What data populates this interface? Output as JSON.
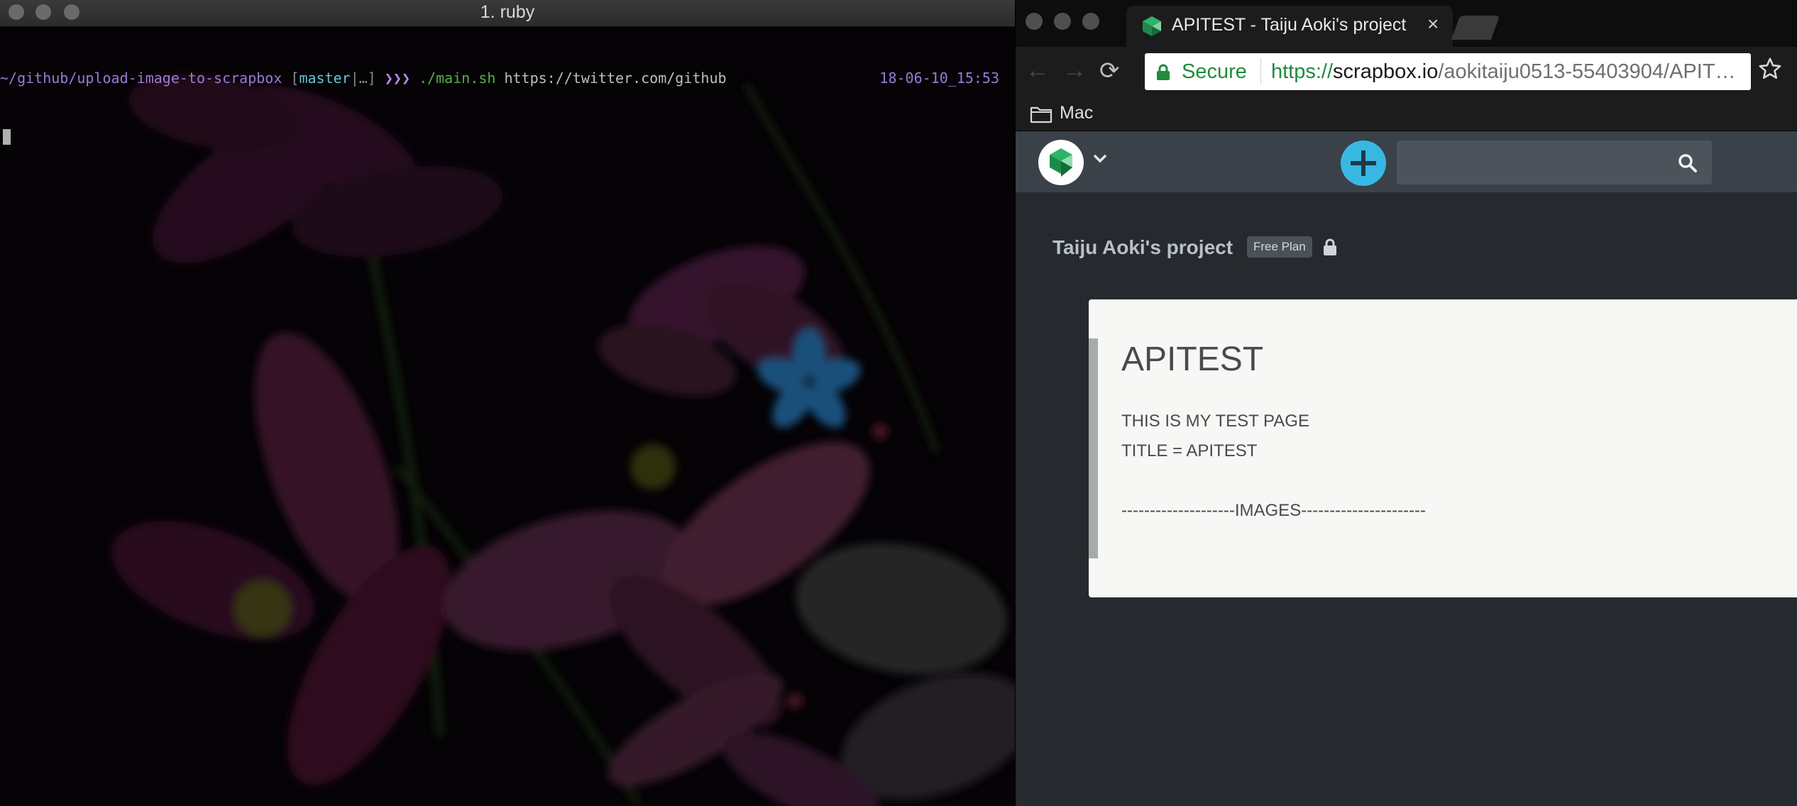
{
  "terminal": {
    "window_title": "1. ruby",
    "prompt_path": "~/github/upload-image-to-scrapbox",
    "branch_open": " [",
    "branch_name": "master",
    "branch_status": "|…",
    "branch_close": "]",
    "prompt_arrows": " ❯❯❯ ",
    "command": "./main.sh",
    "argument": " https://twitter.com/github",
    "timestamp": "18-06-10_15:53"
  },
  "browser": {
    "tab": {
      "title": "APITEST - Taiju Aoki's project",
      "close_glyph": "×",
      "favicon": "scrapbox-logo-icon"
    },
    "nav": {
      "back_glyph": "←",
      "forward_glyph": "→",
      "reload_glyph": "⟳"
    },
    "omnibox": {
      "secure_label": "Secure",
      "url_scheme": "https://",
      "url_host": "scrapbox.io",
      "url_path": "/aokitaiju0513-55403904/APIT…"
    },
    "bookmarks": [
      {
        "label": "Mac",
        "icon": "folder-icon"
      }
    ]
  },
  "scrapbox": {
    "search": {
      "placeholder": ""
    },
    "project": {
      "title": "Taiju Aoki's project",
      "plan_badge": "Free Plan"
    },
    "page": {
      "title": "APITEST",
      "lines": [
        "THIS IS MY TEST PAGE",
        "TITLE = APITEST",
        "",
        "--------------------IMAGES----------------------"
      ]
    },
    "colors": {
      "accent_blue": "#39b7e3",
      "logo_green": "#2fb36a",
      "nav_bg": "#3b4148",
      "page_bg": "#262a2e"
    }
  }
}
